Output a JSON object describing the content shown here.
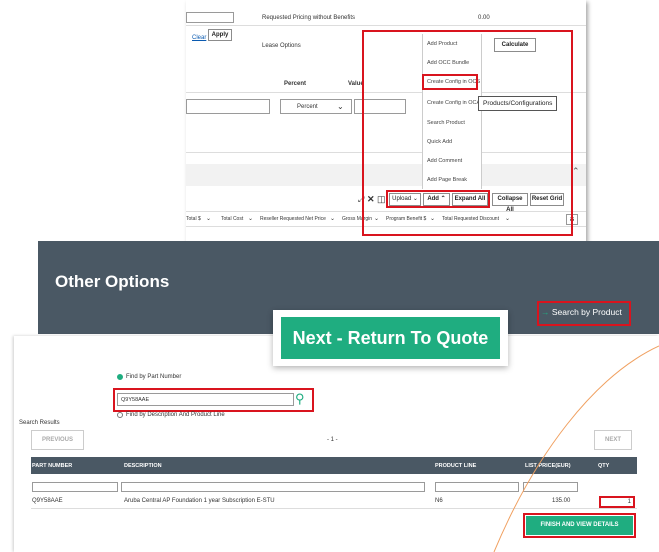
{
  "pricing_panel": {
    "requested_pricing_label": "Requested Pricing without Benefits",
    "requested_pricing_value": "0.00",
    "clear_link": "Clear",
    "apply_button": "Apply",
    "lease_options_label": "Lease Options",
    "percent_header": "Percent",
    "value_header": "Value",
    "percent_select_value": "Percent",
    "calculate_button": "Calculate",
    "add_menu_items": [
      "Add Product",
      "Add OCC Bundle",
      "Create Config in OCS",
      "Create Config in OCA",
      "Search Product",
      "Quick Add",
      "Add Comment",
      "Add Page Break"
    ],
    "tooltip": "Products/Configurations",
    "toolbar": {
      "upload": "Upload",
      "add": "Add",
      "expand_all": "Expand All",
      "collapse_all": "Collapse All",
      "reset_grid": "Reset Grid"
    },
    "columns": [
      "Total $",
      "Total Cost",
      "Reseller Requested Net Price",
      "Gross Margin",
      "Program Benefit $",
      "Total Requested Discount"
    ]
  },
  "other_options": {
    "title": "Other Options",
    "search_by_product": "Search by Product"
  },
  "next_banner": "Next - Return To Quote",
  "search_panel": {
    "find_by_part_label": "Find by Part Number",
    "part_number_value": "Q9Y58AAE",
    "find_by_desc_label": "Find by Description And Product Line",
    "search_results_label": "Search Results",
    "previous_button": "PREVIOUS",
    "next_button": "NEXT",
    "page_indicator": "- 1 -",
    "headers": {
      "part_number": "PART NUMBER",
      "description": "DESCRIPTION",
      "product_line": "PRODUCT LINE",
      "list_price": "LIST PRICE(EUR)",
      "qty": "QTY"
    },
    "row": {
      "part_number": "Q9Y58AAE",
      "description": "Aruba Central AP Foundation 1 year Subscription E-STU",
      "product_line": "N6",
      "list_price": "135.00",
      "qty": "1"
    },
    "finish_button": "FINISH AND VIEW DETAILS"
  },
  "colors": {
    "highlight_red": "#d9141e",
    "hpe_green": "#1fad80",
    "header_slate": "#4a5864"
  }
}
